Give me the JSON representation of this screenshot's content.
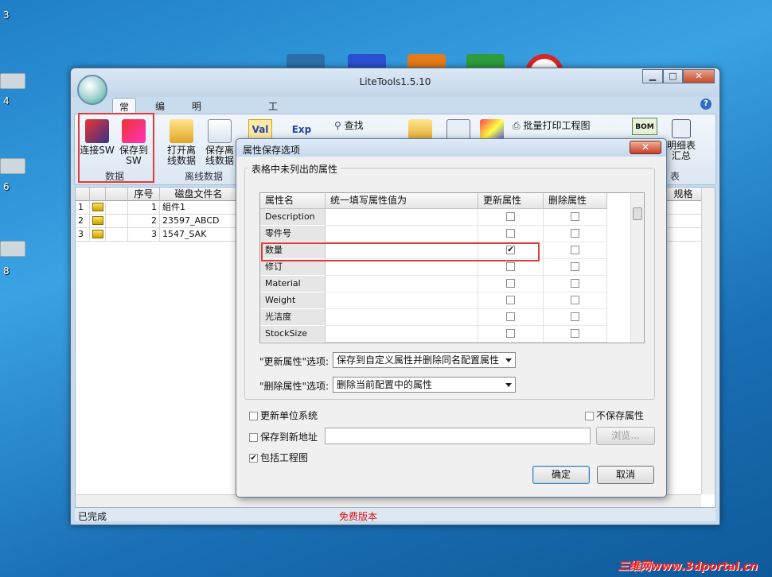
{
  "desktop": {
    "icon_labels": [
      "3",
      "4",
      "6",
      "8"
    ],
    "watermark": "三维网www.3dportal.cn"
  },
  "window": {
    "title": "LiteTools1.5.10",
    "minimize_glyph": "▁",
    "maximize_glyph": "□",
    "close_glyph": "✕",
    "help_glyph": "?",
    "tabs": [
      "常用",
      "编辑",
      "明细表和统计",
      "工具"
    ],
    "ribbon": {
      "connect_sw": "连接SW",
      "save_to_sw_1": "保存到",
      "save_to_sw_2": "SW",
      "group_data": "数据",
      "open_offline_1": "打开离",
      "open_offline_2": "线数据",
      "save_offline_1": "保存离",
      "save_offline_2": "线数据",
      "group_offline": "离线数据",
      "val_label": "Val",
      "exp_label": "Exp",
      "find_label": "查找",
      "batch_print": "批量打印工程图",
      "bom_label": "BOM",
      "detail_1": "明细表",
      "detail_2": "汇总",
      "group_table": "表"
    },
    "grid": {
      "headers": [
        "序号",
        "磁盘文件名",
        "规格"
      ],
      "rows": [
        {
          "n": "1",
          "seq": "1",
          "name": "組件1"
        },
        {
          "n": "2",
          "seq": "2",
          "name": "23597_ABCD"
        },
        {
          "n": "3",
          "seq": "3",
          "name": "1547_SAK"
        }
      ]
    },
    "status": {
      "left": "已完成",
      "center": "免费版本"
    }
  },
  "dialog": {
    "title": "属性保存选项",
    "close_glyph": "✕",
    "group_title": "表格中未列出的属性",
    "columns": [
      "属性名",
      "统一填写属性值为",
      "更新属性",
      "删除属性"
    ],
    "rows": [
      {
        "name": "Description",
        "update": false,
        "delete": false
      },
      {
        "name": "零件号",
        "update": false,
        "delete": false
      },
      {
        "name": "数量",
        "update": true,
        "delete": false
      },
      {
        "name": "修订",
        "update": false,
        "delete": false
      },
      {
        "name": "Material",
        "update": false,
        "delete": false
      },
      {
        "name": "Weight",
        "update": false,
        "delete": false
      },
      {
        "name": "光洁度",
        "update": false,
        "delete": false
      },
      {
        "name": "StockSize",
        "update": false,
        "delete": false
      }
    ],
    "update_option_label": "\"更新属性\"选项:",
    "update_option_value": "保存到自定义属性并删除同名配置属性",
    "delete_option_label": "\"删除属性\"选项:",
    "delete_option_value": "删除当前配置中的属性",
    "update_unit_system": "更新单位系统",
    "no_save_props": "不保存属性",
    "save_to_new_location": "保存到新地址",
    "browse": "浏览...",
    "include_drawing": "包括工程图",
    "include_drawing_checked": true,
    "ok": "确定",
    "cancel": "取消",
    "check_glyph": "✔"
  }
}
